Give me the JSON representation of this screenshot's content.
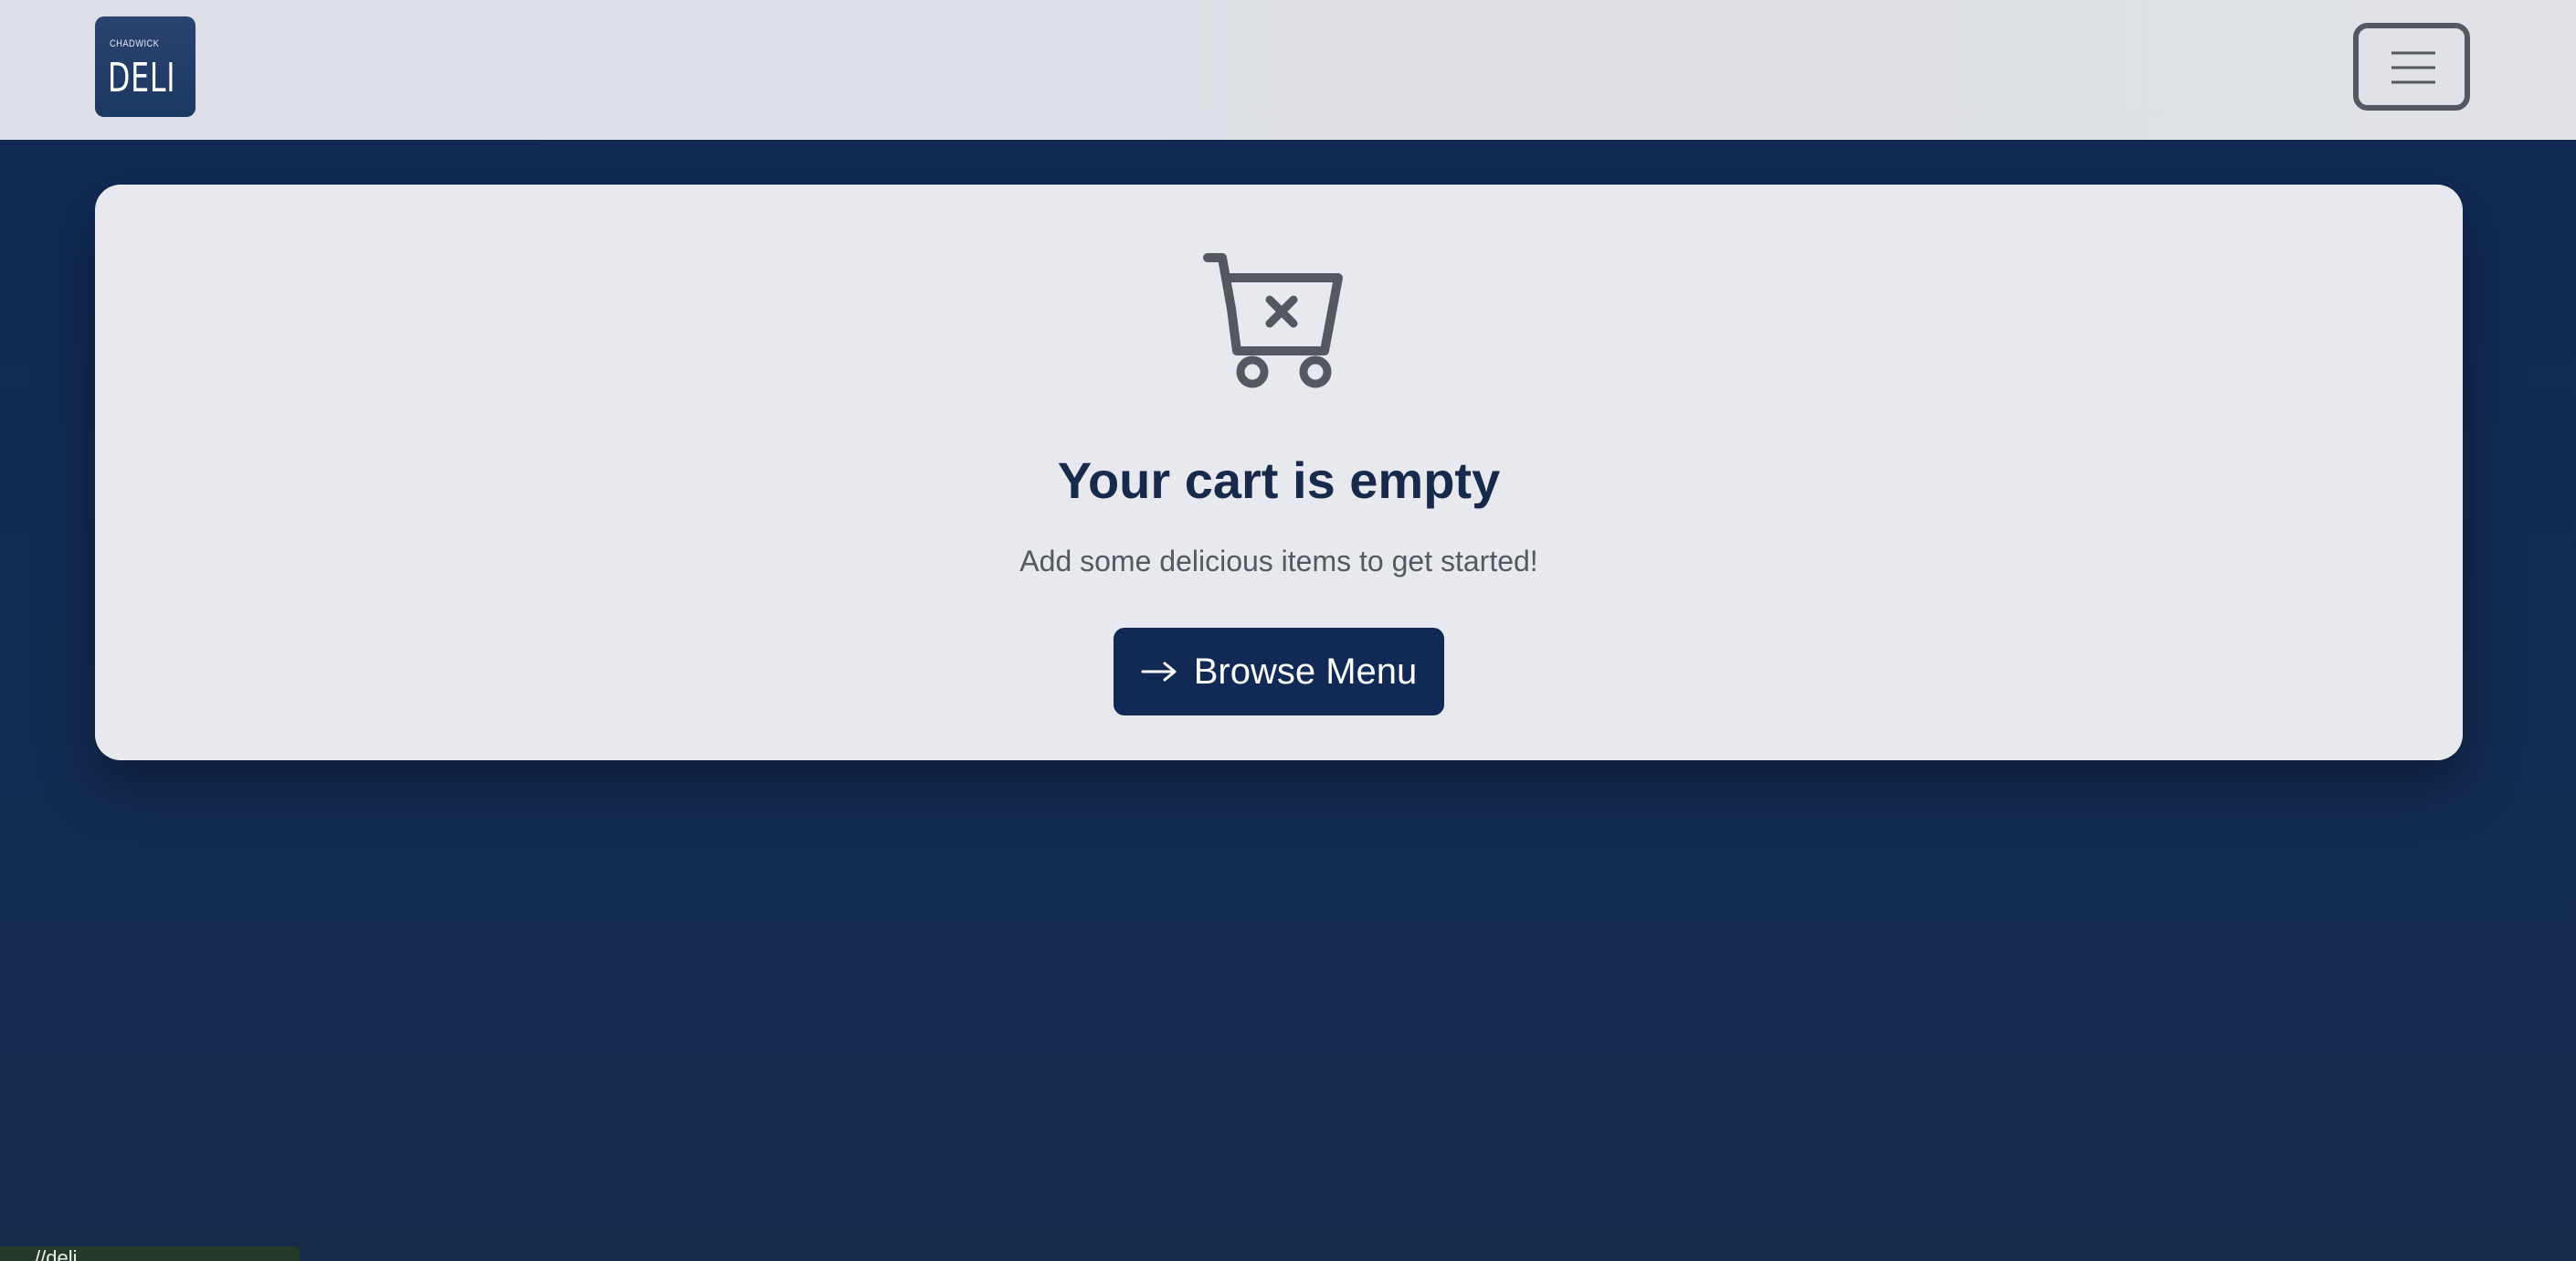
{
  "brand": {
    "logo_small": "CHADWICK",
    "logo_big": "DELI"
  },
  "nav": {
    "toggle_icon": "hamburger-icon"
  },
  "empty_cart": {
    "icon": "cart-x-icon",
    "title": "Your cart is empty",
    "message": "Add some delicious items to get started!",
    "button_icon": "arrow-right-icon",
    "button_label": "Browse Menu"
  },
  "status_bar": {
    "url": "//deli"
  },
  "colors": {
    "navy": "#102a55",
    "card": "#e8e9ee",
    "heading": "#172a4c",
    "muted": "#55585e"
  }
}
